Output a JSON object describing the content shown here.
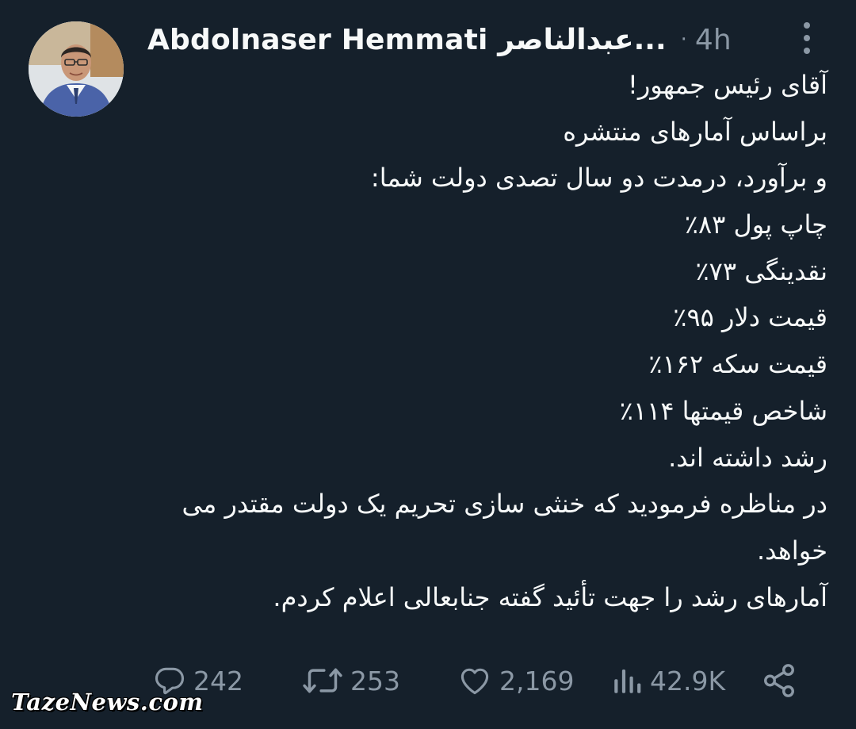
{
  "author": {
    "display_name": "Abdolnaser Hemmati عبدالناصر...",
    "separator": "·",
    "time": "4h"
  },
  "icons": {
    "more": "more-vertical-icon",
    "reply": "comment-icon",
    "retweet": "retweet-icon",
    "like": "heart-icon",
    "views": "analytics-icon",
    "share": "share-icon"
  },
  "tweet": {
    "lines": [
      "آقای رئیس جمهور!",
      "براساس آمارهای منتشره",
      "و برآورد، درمدت دو سال تصدی دولت شما:",
      "چاپ پول ۸۳٪",
      "نقدینگی ۷۳٪",
      "قیمت دلار ۹۵٪",
      "قیمت سکه ۱۶۲٪",
      "شاخص قیمتها ۱۱۴٪",
      "رشد داشته اند.",
      "در مناظره فرمودید که خنثی سازی تحریم یک دولت مقتدر می خواهد.",
      "آمارهای رشد را جهت تأئید گفته جنابعالی اعلام کردم."
    ]
  },
  "stats": {
    "replies": "242",
    "retweets": "253",
    "likes": "2,169",
    "views": "42.9K"
  },
  "watermark": "TazeNews.com",
  "colors": {
    "background": "#15202b",
    "text": "#f7f9f9",
    "muted": "#8b98a5"
  }
}
